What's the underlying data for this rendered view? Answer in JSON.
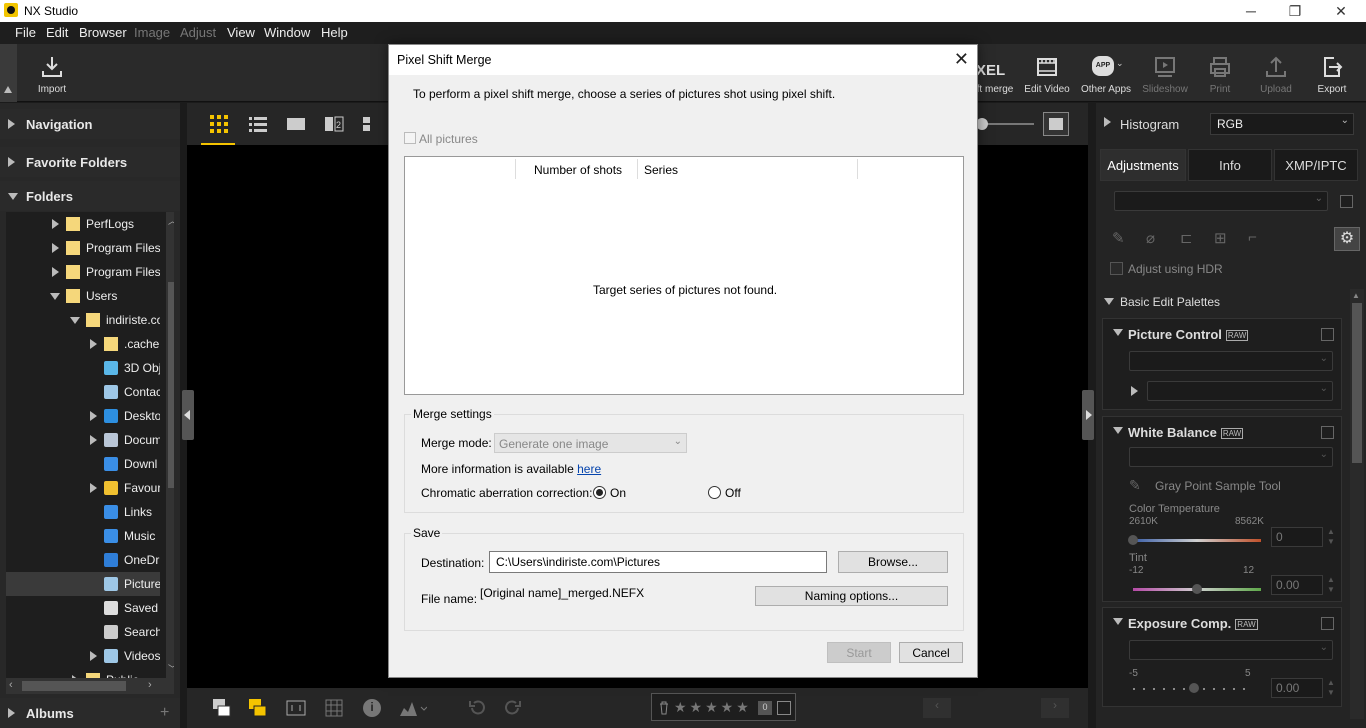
{
  "app": {
    "title": "NX Studio"
  },
  "menu": [
    "File",
    "Edit",
    "Browser",
    "Image",
    "Adjust",
    "View",
    "Window",
    "Help"
  ],
  "menu_disabled": [
    "Image",
    "Adjust"
  ],
  "toolbar": {
    "import": "Import",
    "pixel_partial": "XEL",
    "merge_partial": "ft merge",
    "edit_video": "Edit Video",
    "other_apps": "Other Apps",
    "app_badge": "APP",
    "slideshow": "Slideshow",
    "print": "Print",
    "upload": "Upload",
    "export": "Export"
  },
  "left": {
    "navigation": "Navigation",
    "favorite_folders": "Favorite Folders",
    "folders": "Folders",
    "albums": "Albums",
    "tree": [
      {
        "label": "PerfLogs",
        "icon": "folder-icon",
        "level": 0,
        "arrow": "right"
      },
      {
        "label": "Program Files",
        "icon": "folder-icon",
        "level": 0,
        "arrow": "right"
      },
      {
        "label": "Program Files (",
        "icon": "folder-icon",
        "level": 0,
        "arrow": "right"
      },
      {
        "label": "Users",
        "icon": "folder-icon",
        "level": 0,
        "arrow": "down"
      },
      {
        "label": "indiriste.co",
        "icon": "folder-icon",
        "level": 1,
        "arrow": "down"
      },
      {
        "label": ".cache",
        "icon": "folder-icon",
        "level": 2,
        "arrow": "right"
      },
      {
        "label": "3D Obj",
        "icon": "cube-icon",
        "level": 2,
        "arrow": ""
      },
      {
        "label": "Contac",
        "icon": "contacts-icon",
        "level": 2,
        "arrow": ""
      },
      {
        "label": "Deskto",
        "icon": "desktop-icon",
        "level": 2,
        "arrow": "right"
      },
      {
        "label": "Docum",
        "icon": "document-icon",
        "level": 2,
        "arrow": "right"
      },
      {
        "label": "Downl",
        "icon": "download-icon",
        "level": 2,
        "arrow": ""
      },
      {
        "label": "Favour",
        "icon": "star-icon",
        "level": 2,
        "arrow": "right"
      },
      {
        "label": "Links",
        "icon": "link-icon",
        "level": 2,
        "arrow": ""
      },
      {
        "label": "Music",
        "icon": "music-icon",
        "level": 2,
        "arrow": ""
      },
      {
        "label": "OneDr",
        "icon": "cloud-icon",
        "level": 2,
        "arrow": ""
      },
      {
        "label": "Picture",
        "icon": "pictures-icon",
        "level": 2,
        "arrow": "",
        "selected": true
      },
      {
        "label": "Saved G",
        "icon": "saved-games-icon",
        "level": 2,
        "arrow": ""
      },
      {
        "label": "Search",
        "icon": "search-icon",
        "level": 2,
        "arrow": ""
      },
      {
        "label": "Videos",
        "icon": "video-icon",
        "level": 2,
        "arrow": "right"
      },
      {
        "label": "Public",
        "icon": "folder-icon",
        "level": 1,
        "arrow": "right"
      }
    ]
  },
  "right": {
    "histogram": "Histogram",
    "histogram_mode": "RGB",
    "tabs": [
      "Adjustments",
      "Info",
      "XMP/IPTC"
    ],
    "adjust_hdr": "Adjust using HDR",
    "basic_palettes": "Basic Edit Palettes",
    "picture_control": "Picture Control",
    "white_balance": "White Balance",
    "gray_point": "Gray Point Sample Tool",
    "color_temp": "Color Temperature",
    "temp_min": "2610K",
    "temp_max": "8562K",
    "temp_value": "0",
    "tint": "Tint",
    "tint_min": "-12",
    "tint_max": "12",
    "tint_value": "0.00",
    "exposure": "Exposure Comp.",
    "exp_min": "-5",
    "exp_max": "5",
    "exp_value": "0.00",
    "raw_badge": "RAW"
  },
  "dialog": {
    "title": "Pixel Shift Merge",
    "intro": "To perform a pixel shift merge, choose a series of pictures shot using pixel shift.",
    "all_pictures": "All pictures",
    "columns": [
      "Number of shots",
      "Series"
    ],
    "empty_message": "Target series of pictures not found.",
    "merge_settings": "Merge settings",
    "merge_mode_label": "Merge mode:",
    "merge_mode_value": "Generate one image",
    "more_info": "More information is available",
    "here": "here",
    "chromatic_label": "Chromatic aberration correction:",
    "on": "On",
    "off": "Off",
    "chromatic_selected": "On",
    "save": "Save",
    "destination_label": "Destination:",
    "destination_value": "C:\\Users\\indiriste.com\\Pictures",
    "browse": "Browse...",
    "filename_label": "File name:",
    "filename_value": "[Original name]_merged.NEFX",
    "naming_options": "Naming options...",
    "start": "Start",
    "cancel": "Cancel"
  },
  "colors": {
    "accent": "#f5c400",
    "link": "#0645ad"
  }
}
